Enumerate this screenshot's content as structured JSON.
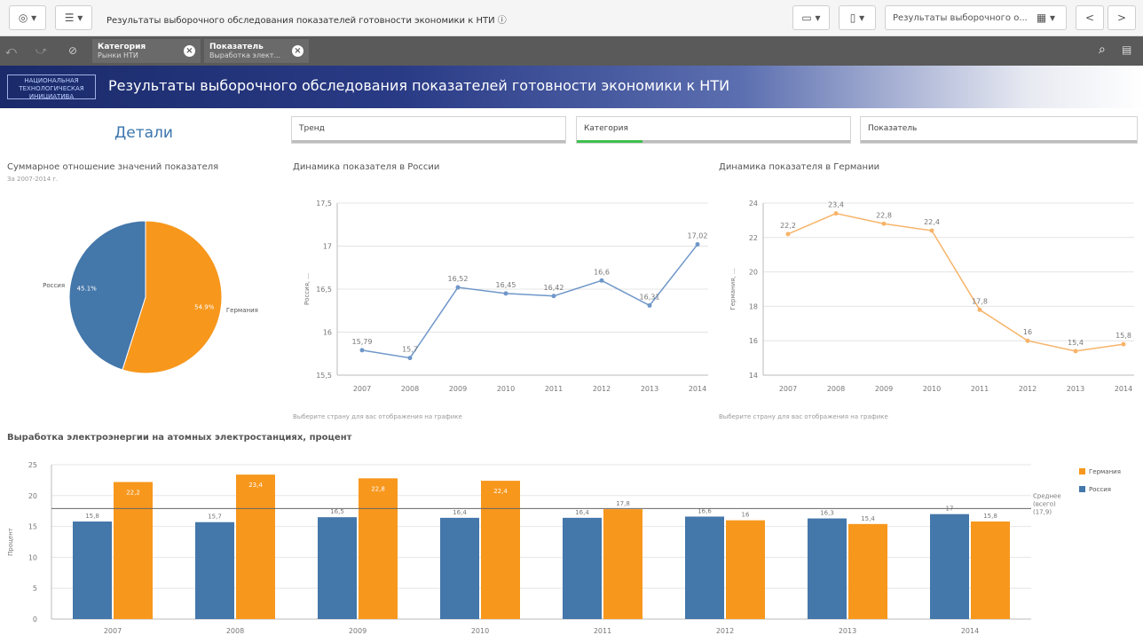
{
  "toolbar": {
    "nav_icon": "compass-icon",
    "menu_icon": "list-icon",
    "app_title": "Результаты выборочного обследования показателей готовности экономики к НТИ",
    "present_icon": "presentation-icon",
    "bookmark_icon": "bookmark-icon",
    "sheet_title": "Результаты выборочного о...",
    "prev": "<",
    "next": ">"
  },
  "selections": [
    {
      "field": "Категория",
      "value": "Рынки НТИ"
    },
    {
      "field": "Показатель",
      "value": "Выработка элект..."
    }
  ],
  "banner": {
    "logo_text": "НАЦИОНАЛЬНАЯ ТЕХНОЛОГИЧЕСКАЯ ИНИЦИАТИВА",
    "title": "Результаты выборочного обследования показателей готовности экономики к НТИ"
  },
  "details_label": "Детали",
  "filters": [
    {
      "label": "Тренд",
      "progress": 0
    },
    {
      "label": "Категория",
      "progress": 0.24
    },
    {
      "label": "Показатель",
      "progress": 0
    }
  ],
  "pie_section": {
    "title": "Суммарное отношение значений показателя",
    "subtitle": "За 2007-2014 г."
  },
  "russia_section": {
    "title": "Динамика показателя в России",
    "hint": "Выберите страну для вас отображения на графике"
  },
  "germany_section": {
    "title": "Динамика показателя в Германии",
    "hint": "Выберите страну для вас отображения на графике"
  },
  "bar_section": {
    "title": "Выработка электроэнергии на атомных электростанциях, процент"
  },
  "colors": {
    "russia": "#4477aa",
    "germany": "#f7971c",
    "line_ru": "#6f97c9",
    "line_de": "#f7b46a"
  },
  "chart_data": [
    {
      "type": "pie",
      "slices": [
        {
          "label": "Россия",
          "value": 45.1,
          "label_text": "45.1%"
        },
        {
          "label": "Германия",
          "value": 54.9,
          "label_text": "54.9%"
        }
      ]
    },
    {
      "type": "line",
      "x": [
        "2007",
        "2008",
        "2009",
        "2010",
        "2011",
        "2012",
        "2013",
        "2014"
      ],
      "series": [
        {
          "values": [
            15.79,
            15.7,
            16.52,
            16.45,
            16.42,
            16.6,
            16.31,
            17.02
          ],
          "labels": [
            "15,79",
            "15,7",
            "16,52",
            "16,45",
            "16,42",
            "16,6",
            "16,31",
            "17,02"
          ]
        }
      ],
      "ylabel": "Россия, ...",
      "ylim": [
        15.5,
        17.5
      ],
      "yticks": [
        15.5,
        16,
        16.5,
        17,
        17.5
      ],
      "ytick_labels": [
        "15,5",
        "16",
        "16,5",
        "17",
        "17,5"
      ]
    },
    {
      "type": "line",
      "x": [
        "2007",
        "2008",
        "2009",
        "2010",
        "2011",
        "2012",
        "2013",
        "2014"
      ],
      "series": [
        {
          "values": [
            22.2,
            23.4,
            22.8,
            22.4,
            17.8,
            16,
            15.4,
            15.8
          ],
          "labels": [
            "22,2",
            "23,4",
            "22,8",
            "22,4",
            "17,8",
            "16",
            "15,4",
            "15,8"
          ]
        }
      ],
      "ylabel": "Германия, ...",
      "ylim": [
        14,
        24
      ],
      "yticks": [
        14,
        16,
        18,
        20,
        22,
        24
      ],
      "ytick_labels": [
        "14",
        "16",
        "18",
        "20",
        "22",
        "24"
      ]
    },
    {
      "type": "bar",
      "categories": [
        "2007",
        "2008",
        "2009",
        "2010",
        "2011",
        "2012",
        "2013",
        "2014"
      ],
      "series": [
        {
          "name": "Россия",
          "values": [
            15.8,
            15.7,
            16.5,
            16.4,
            16.4,
            16.6,
            16.3,
            17
          ],
          "labels": [
            "15,8",
            "15,7",
            "16,5",
            "16,4",
            "16,4",
            "16,6",
            "16,3",
            "17"
          ]
        },
        {
          "name": "Германия",
          "values": [
            22.2,
            23.4,
            22.8,
            22.4,
            17.8,
            16,
            15.4,
            15.8
          ],
          "labels": [
            "22,2",
            "23,4",
            "22,8",
            "22,4",
            "17,8",
            "16",
            "15,4",
            "15,8"
          ]
        }
      ],
      "ylabel": "Процент",
      "ylim": [
        0,
        25
      ],
      "yticks": [
        0,
        5,
        10,
        15,
        20,
        25
      ],
      "ytick_labels": [
        "0",
        "5",
        "10",
        "15",
        "20",
        "25"
      ],
      "reference_line": {
        "value": 17.9,
        "label": [
          "Среднее",
          "(всего)",
          "(17,9)"
        ]
      },
      "legend": [
        "Германия",
        "Россия"
      ],
      "legend_placement": "right"
    }
  ]
}
